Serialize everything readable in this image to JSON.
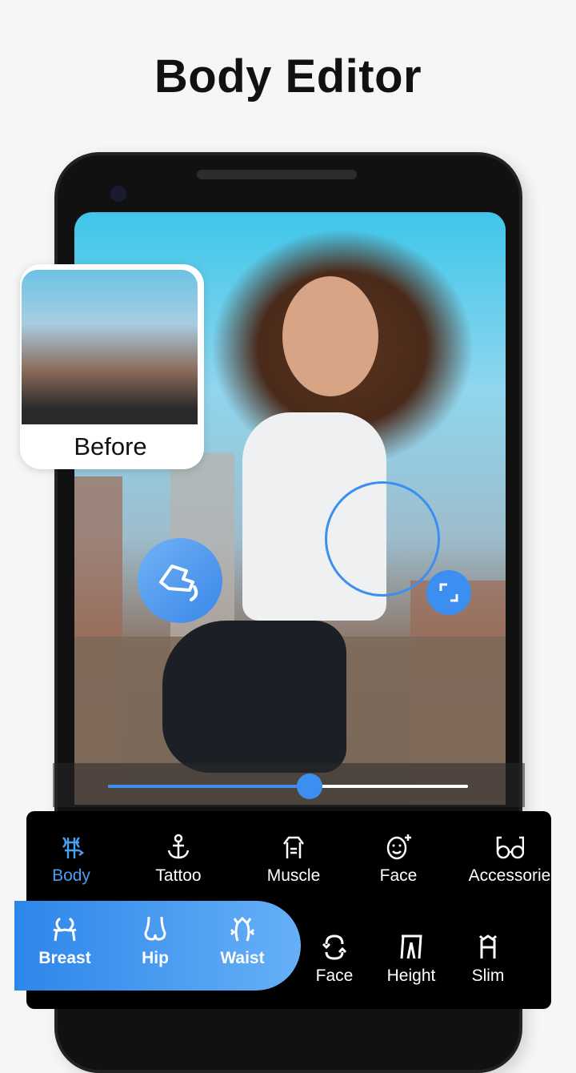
{
  "title": "Body Editor",
  "before_label": "Before",
  "slider": {
    "value": 0.56
  },
  "colors": {
    "accent": "#3c8ff0",
    "panel": "#000000",
    "background": "#f6f6f6"
  },
  "top_tools": [
    {
      "label": "Body",
      "icon": "body-icon",
      "active": true
    },
    {
      "label": "Tattoo",
      "icon": "anchor-icon"
    },
    {
      "label": "Muscle",
      "icon": "muscle-icon"
    },
    {
      "label": "Face",
      "icon": "face-smile-icon"
    },
    {
      "label": "Accessorie",
      "icon": "glasses-icon"
    }
  ],
  "sub_tools": [
    {
      "label": "Breast",
      "icon": "breast-icon"
    },
    {
      "label": "Hip",
      "icon": "hip-icon"
    },
    {
      "label": "Waist",
      "icon": "waist-icon"
    },
    {
      "label": "Face",
      "icon": "face-reshape-icon"
    },
    {
      "label": "Height",
      "icon": "legs-icon"
    },
    {
      "label": "Slim",
      "icon": "slim-icon"
    }
  ]
}
